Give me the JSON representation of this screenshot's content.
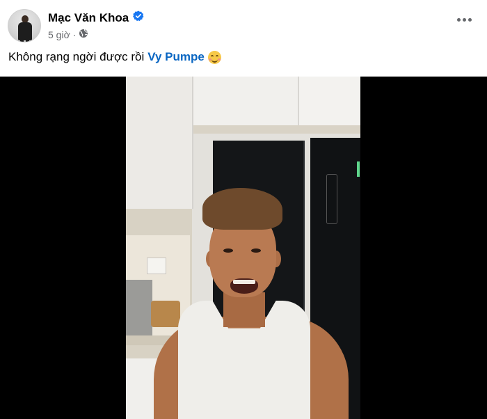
{
  "post": {
    "author": "Mạc Văn Khoa",
    "time": "5 giờ",
    "caption_text": "Không rạng ngời được rồi",
    "mention": "Vy Pumpe"
  },
  "icons": {
    "verified": "verified-badge-icon",
    "audience": "globe-icon",
    "more": "more-options-icon",
    "emoji": "smiling-face-emoji"
  },
  "colors": {
    "mention": "#0a66c2",
    "verified": "#1877f2",
    "meta": "#65676b",
    "video_bg": "#000000"
  }
}
